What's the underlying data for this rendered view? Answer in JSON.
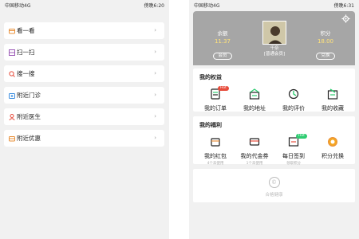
{
  "left": {
    "status": {
      "carrier": "中国移动4G",
      "battery": "傍晚6:20"
    },
    "menu": [
      {
        "label": "看一看",
        "icon": "wallet-icon",
        "color": "#e8903a"
      },
      {
        "label": "扫一扫",
        "icon": "scan-icon",
        "color": "#9b59b6"
      },
      {
        "label": "搜一搜",
        "icon": "search-icon",
        "color": "#e74c3c"
      },
      {
        "label": "附近门诊",
        "icon": "clinic-icon",
        "color": "#3b8de0"
      },
      {
        "label": "附近医生",
        "icon": "doctor-icon",
        "color": "#e74c3c"
      },
      {
        "label": "附近优惠",
        "icon": "coupon-icon",
        "color": "#e8903a"
      }
    ]
  },
  "right": {
    "status": {
      "carrier": "中国移动4G",
      "battery": "傍晚6:31"
    },
    "header": {
      "balance_label": "余额",
      "balance_value": "11.37",
      "balance_button": "会员",
      "points_label": "积分",
      "points_value": "18.00",
      "points_button": "兑换",
      "username": "千奈",
      "member_level": "[普通会员]"
    },
    "rights": {
      "title": "我的权益",
      "items": [
        {
          "label": "我的订单",
          "badge": "Hot",
          "badge_color": "#e74c3c",
          "icon": "order-icon"
        },
        {
          "label": "我的地址",
          "icon": "address-icon"
        },
        {
          "label": "我的评价",
          "icon": "review-icon"
        },
        {
          "label": "我的收藏",
          "icon": "favorite-icon"
        }
      ]
    },
    "welfare": {
      "title": "我的福利",
      "items": [
        {
          "label": "我的红包",
          "sub": "4个未使用",
          "icon": "red-packet-icon"
        },
        {
          "label": "我的代金券",
          "sub": "1个未使用",
          "icon": "voucher-icon"
        },
        {
          "label": "每日签到",
          "sub": "领取积分",
          "badge": "Hot",
          "badge_color": "#2ecc71",
          "icon": "checkin-icon"
        },
        {
          "label": "积分兑换",
          "icon": "points-exchange-icon"
        }
      ]
    },
    "footer": {
      "text": "合格健康",
      "icon": "copyright-icon"
    }
  }
}
